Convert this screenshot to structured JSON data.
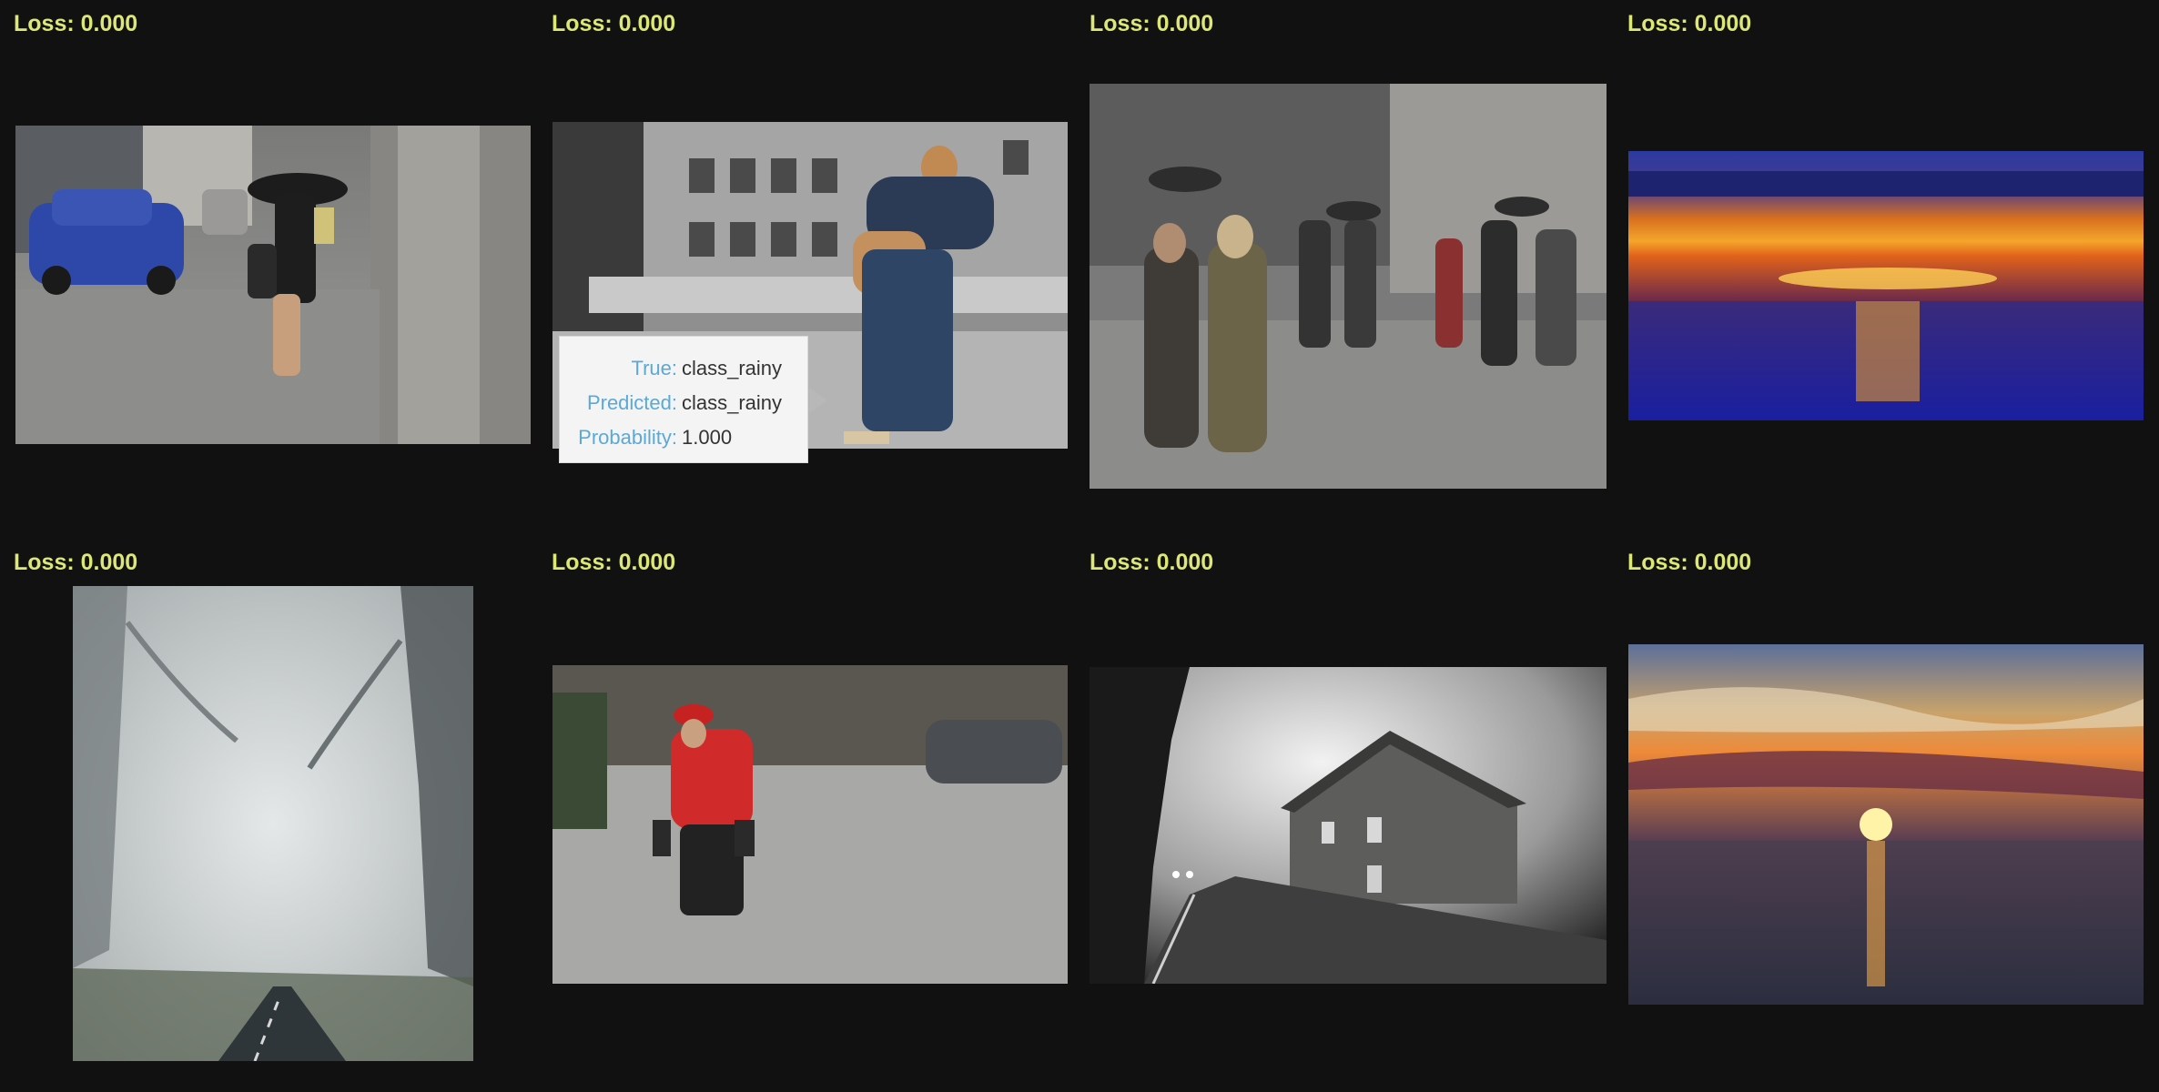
{
  "cells": [
    {
      "loss_label": "Loss: ",
      "loss_value": "0.000",
      "scene": "rainy street woman with umbrella"
    },
    {
      "loss_label": "Loss: ",
      "loss_value": "0.000",
      "scene": "couple kissing in rain"
    },
    {
      "loss_label": "Loss: ",
      "loss_value": "0.000",
      "scene": "pedestrians in rain"
    },
    {
      "loss_label": "Loss: ",
      "loss_value": "0.000",
      "scene": "sunset over sea"
    },
    {
      "loss_label": "Loss: ",
      "loss_value": "0.000",
      "scene": "foggy forest road"
    },
    {
      "loss_label": "Loss: ",
      "loss_value": "0.000",
      "scene": "man in red jacket in rain"
    },
    {
      "loss_label": "Loss: ",
      "loss_value": "0.000",
      "scene": "foggy house road"
    },
    {
      "loss_label": "Loss: ",
      "loss_value": "0.000",
      "scene": "sunset clouds over sea"
    }
  ],
  "tooltip": {
    "true_label": "True:",
    "true_value": "class_rainy",
    "predicted_label": "Predicted:",
    "predicted_value": "class_rainy",
    "probability_label": "Probability:",
    "probability_value": "1.000"
  },
  "colors": {
    "background": "#111111",
    "loss_text": "#dce775",
    "tooltip_key": "#5aa9d6"
  }
}
